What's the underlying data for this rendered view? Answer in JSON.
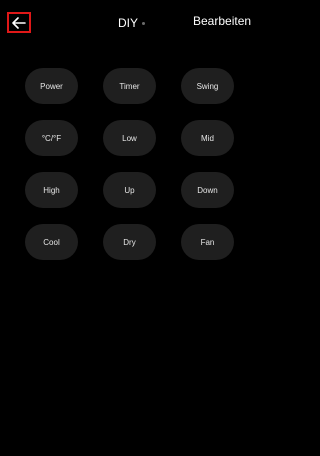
{
  "header": {
    "back_icon": "arrow-left-icon",
    "title": "DIY",
    "edit_label": "Bearbeiten"
  },
  "colors": {
    "background": "#000000",
    "button_bg": "#1f1f1f",
    "text": "#ffffff",
    "highlight_border": "#e01818"
  },
  "buttons": [
    {
      "label": "Power"
    },
    {
      "label": "Timer"
    },
    {
      "label": "Swing"
    },
    {
      "label": "°C/°F"
    },
    {
      "label": "Low"
    },
    {
      "label": "Mid"
    },
    {
      "label": "High"
    },
    {
      "label": "Up"
    },
    {
      "label": "Down"
    },
    {
      "label": "Cool"
    },
    {
      "label": "Dry"
    },
    {
      "label": "Fan"
    }
  ]
}
